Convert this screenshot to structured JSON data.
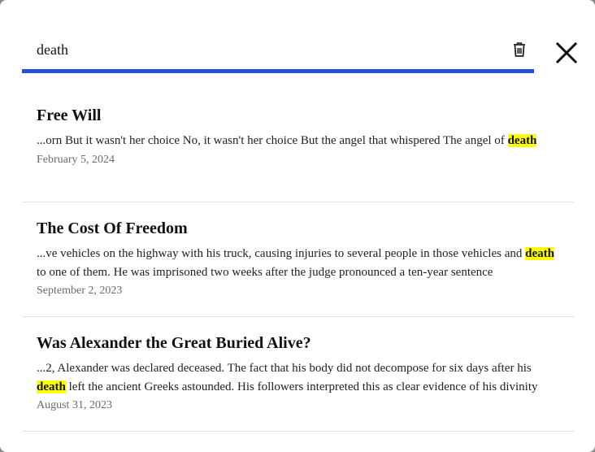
{
  "search": {
    "query": "death"
  },
  "results": [
    {
      "title": "Free Will",
      "before": "...orn But it wasn't her choice No, it wasn't her choice But the angel that whispered The angel of ",
      "highlight": "death",
      "after": "",
      "date": "February 5, 2024"
    },
    {
      "title": "The Cost Of Freedom",
      "before": "...ve vehicles on the highway with his truck, causing injuries to several people in those vehicles and ",
      "highlight": "death",
      "after": " to one of them. He was imprisoned two weeks after the judge pronounced a ten-year sentence",
      "date": "September 2, 2023"
    },
    {
      "title": "Was Alexander the Great Buried Alive?",
      "before": "...2, Alexander was declared deceased. The fact that his body did not decompose for six days after his ",
      "highlight": "death",
      "after": " left the ancient Greeks astounded. His followers interpreted this as clear evidence of his divinity",
      "date": "August 31, 2023"
    }
  ],
  "colors": {
    "accent": "#2451d6",
    "highlight": "#ffff00"
  }
}
